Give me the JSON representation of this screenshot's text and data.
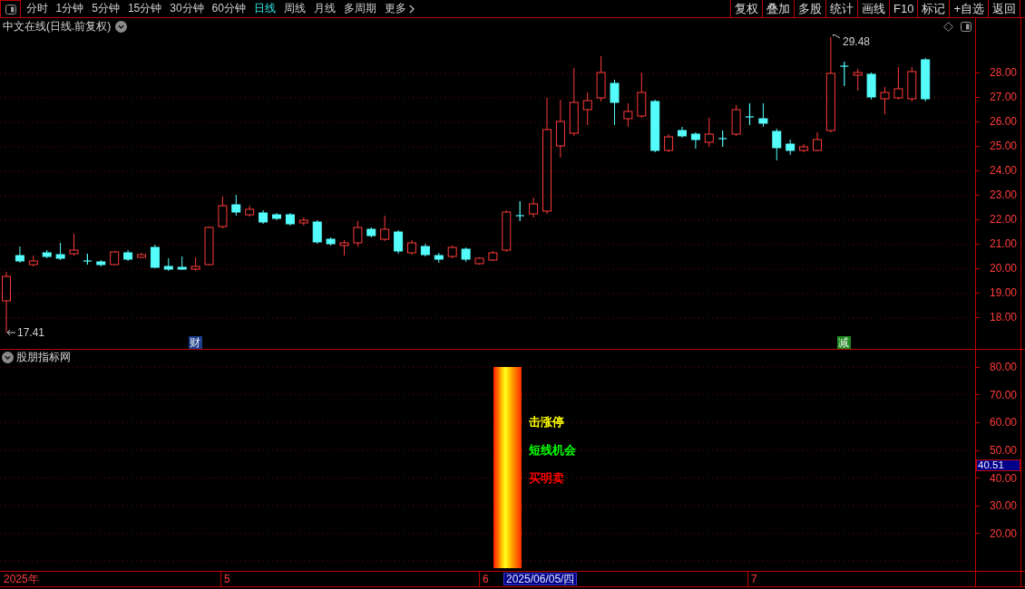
{
  "toolbar": {
    "periods": [
      {
        "label": "分时",
        "selected": false
      },
      {
        "label": "1分钟",
        "selected": false
      },
      {
        "label": "5分钟",
        "selected": false
      },
      {
        "label": "15分钟",
        "selected": false
      },
      {
        "label": "30分钟",
        "selected": false
      },
      {
        "label": "60分钟",
        "selected": false
      },
      {
        "label": "日线",
        "selected": true
      },
      {
        "label": "周线",
        "selected": false
      },
      {
        "label": "月线",
        "selected": false
      },
      {
        "label": "多周期",
        "selected": false
      }
    ],
    "more": "更多",
    "buttons": [
      "复权",
      "叠加",
      "多股",
      "统计",
      "画线",
      "F10",
      "标记",
      "+自选",
      "返回"
    ]
  },
  "price_chart": {
    "title": "中文在线(日线.前复权)",
    "axis_labels": [
      "28.00",
      "27.00",
      "26.00",
      "25.00",
      "24.00",
      "23.00",
      "22.00",
      "21.00",
      "20.00",
      "19.00",
      "18.00"
    ],
    "high_label": "29.48",
    "low_label": "17.41",
    "event_markers": [
      {
        "label": "财",
        "color": "#1c3d8c"
      },
      {
        "label": "减",
        "color": "#1f8a1f"
      }
    ]
  },
  "indicator": {
    "title": "股朋指标网",
    "axis_labels": [
      "80.00",
      "70.00",
      "60.00",
      "50.00",
      "40.00",
      "30.00",
      "20.00"
    ],
    "current_value": "40.51",
    "signals": [
      {
        "text": "击涨停",
        "color": "#ffff00"
      },
      {
        "text": "短线机会",
        "color": "#00ff00"
      },
      {
        "text": "买明卖",
        "color": "#ff0000"
      }
    ]
  },
  "time_axis": {
    "labels": [
      "2025年",
      "5",
      "6",
      "7"
    ],
    "cursor_date": "2025/06/05/四"
  }
}
